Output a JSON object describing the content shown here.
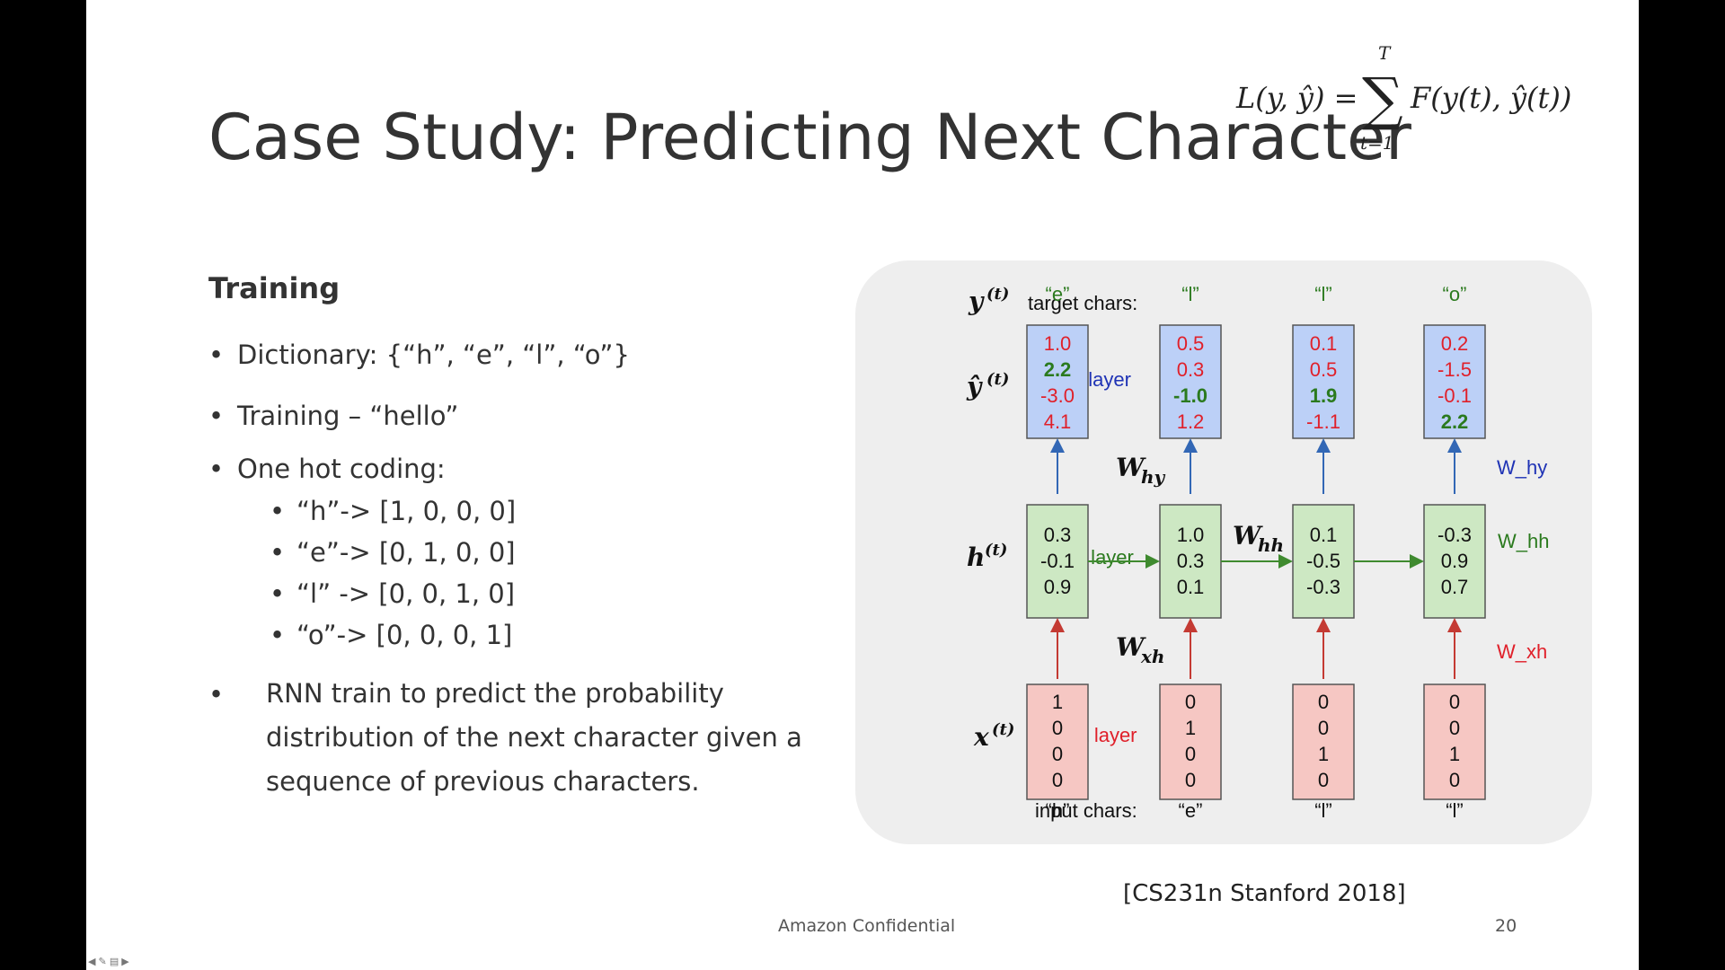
{
  "slide": {
    "title": "Case Study: Predicting Next Character",
    "formula": {
      "lhs": "L(y, ŷ) =",
      "sum_upper": "T",
      "sum_lower": "t=1",
      "rhs": "F(y(t), ŷ(t))"
    },
    "training": {
      "heading": "Training",
      "bullets": [
        "Dictionary: {“h”, “e”, “l”, “o”}",
        "Training – “hello”",
        "One hot coding:"
      ],
      "sub_bullets": [
        "“h”-> [1, 0, 0, 0]",
        "“e”-> [0, 1, 0, 0]",
        "“l” -> [0, 0, 1, 0]",
        "“o”-> [0, 0, 0, 1]"
      ],
      "paragraph": "RNN train to predict the probability distribution of the next character given a sequence of previous characters."
    },
    "diagram": {
      "row_labels": {
        "target": "target chars:",
        "output": "output layer",
        "hidden": "hidden layer",
        "input": "input layer",
        "input_chars": "input chars:"
      },
      "symbols": {
        "y": "y",
        "yhat": "ŷ",
        "h": "h",
        "x": "x",
        "sup": "(t)"
      },
      "weights": {
        "Why": "W",
        "Why_sub": "hy",
        "Whh": "W",
        "Whh_sub": "hh",
        "Wxh": "W",
        "Wxh_sub": "xh",
        "Why_plain": "W_hy",
        "Whh_plain": "W_hh",
        "Wxh_plain": "W_xh"
      },
      "target_chars": [
        "“e”",
        "“l”",
        "“l”",
        "“o”"
      ],
      "input_chars": [
        "“h”",
        "“e”",
        "“l”",
        "“l”"
      ],
      "output_values": [
        [
          "1.0",
          "2.2",
          "-3.0",
          "4.1"
        ],
        [
          "0.5",
          "0.3",
          "-1.0",
          "1.2"
        ],
        [
          "0.1",
          "0.5",
          "1.9",
          "-1.1"
        ],
        [
          "0.2",
          "-1.5",
          "-0.1",
          "2.2"
        ]
      ],
      "output_bold_index": [
        1,
        2,
        2,
        3
      ],
      "hidden_values": [
        [
          "0.3",
          "-0.1",
          "0.9"
        ],
        [
          "1.0",
          "0.3",
          "0.1"
        ],
        [
          "0.1",
          "-0.5",
          "-0.3"
        ],
        [
          "-0.3",
          "0.9",
          "0.7"
        ]
      ],
      "input_values": [
        [
          "1",
          "0",
          "0",
          "0"
        ],
        [
          "0",
          "1",
          "0",
          "0"
        ],
        [
          "0",
          "0",
          "1",
          "0"
        ],
        [
          "0",
          "0",
          "1",
          "0"
        ]
      ],
      "colors": {
        "output_fill": "#bcd0f7",
        "hidden_fill": "#cde8c3",
        "input_fill": "#f6c7c3",
        "red_text": "#e0202a",
        "green_text": "#2b7a1e",
        "blue_text": "#1f33b5",
        "arrow_blue": "#3267b5",
        "arrow_green": "#3f8a2f",
        "arrow_red": "#c43a33"
      }
    },
    "source": "[CS231n Stanford 2018]",
    "footer": "Amazon Confidential",
    "page_number": "20"
  }
}
